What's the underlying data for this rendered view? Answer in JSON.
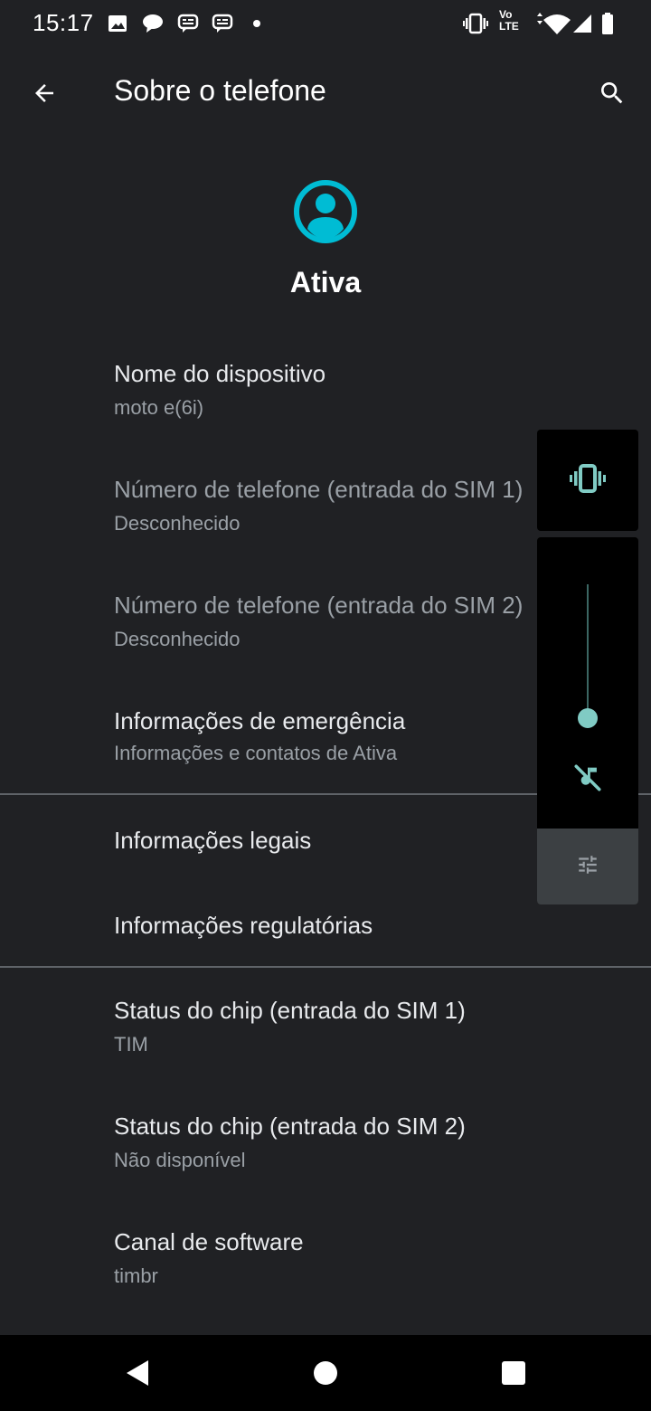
{
  "status_bar": {
    "time": "15:17",
    "notification_icons": [
      "image-icon",
      "chat-bubble-icon",
      "message-icon",
      "message-icon",
      "dot-icon"
    ],
    "system_icons": [
      "vibrate-icon",
      "volte-icon",
      "wifi-icon",
      "signal-icon",
      "battery-icon"
    ],
    "volte_label_top": "Vo",
    "volte_label_bottom": "LTE"
  },
  "app_bar": {
    "title": "Sobre o telefone",
    "back_icon": "arrow-back-icon",
    "search_icon": "search-icon"
  },
  "profile": {
    "name": "Ativa",
    "avatar_icon": "account-circle-icon",
    "accent_color": "#00bcd4"
  },
  "items": [
    {
      "title": "Nome do dispositivo",
      "subtitle": "moto e(6i)"
    },
    {
      "title": "Número de telefone (entrada do SIM 1)",
      "subtitle": "Desconhecido"
    },
    {
      "title": "Número de telefone (entrada do SIM 2)",
      "subtitle": "Desconhecido"
    },
    {
      "title": "Informações de emergência",
      "subtitle": "Informações e contatos de Ativa"
    },
    {
      "title": "Informações legais"
    },
    {
      "title": "Informações regulatórias"
    },
    {
      "title": "Status do chip (entrada do SIM 1)",
      "subtitle": "TIM"
    },
    {
      "title": "Status do chip (entrada do SIM 2)",
      "subtitle": "Não disponível"
    },
    {
      "title": "Canal de software",
      "subtitle": "timbr"
    }
  ],
  "volume_panel": {
    "ringer_mode_icon": "vibrate-icon",
    "level": 0,
    "mute_icon": "music-off-icon",
    "settings_icon": "tune-icon",
    "accent_color": "#80cbc4"
  },
  "nav_bar": {
    "back_icon": "nav-back-icon",
    "home_icon": "nav-home-icon",
    "recents_icon": "nav-recents-icon"
  }
}
